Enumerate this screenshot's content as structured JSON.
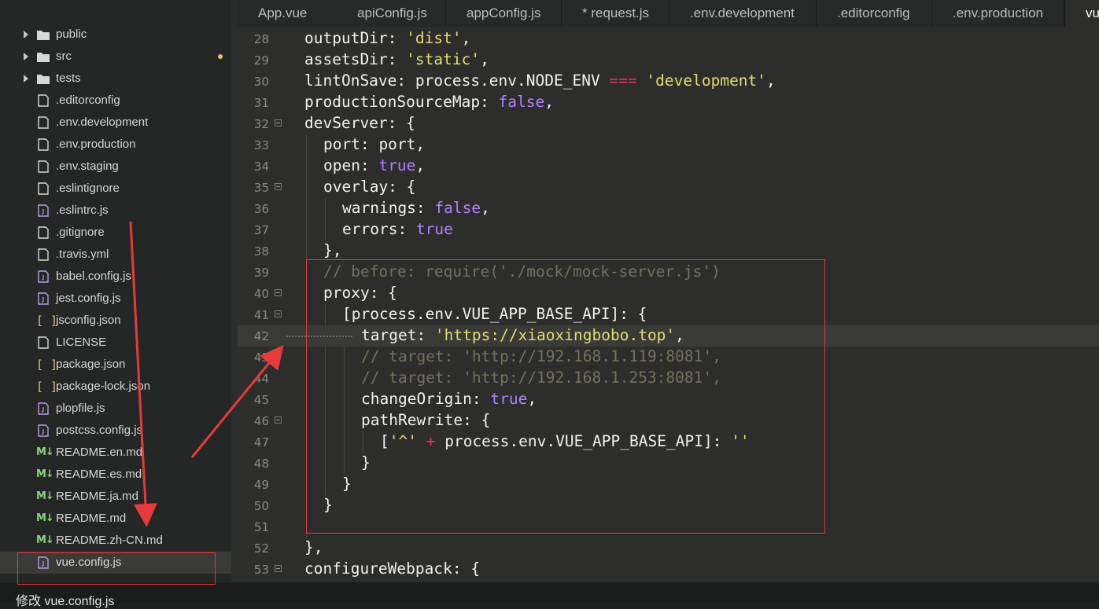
{
  "sidebar": {
    "items": [
      {
        "label": "public",
        "type": "folder"
      },
      {
        "label": "src",
        "type": "folder",
        "modified": true
      },
      {
        "label": "tests",
        "type": "folder"
      },
      {
        "label": ".editorconfig",
        "type": "file"
      },
      {
        "label": ".env.development",
        "type": "file"
      },
      {
        "label": ".env.production",
        "type": "file"
      },
      {
        "label": ".env.staging",
        "type": "file"
      },
      {
        "label": ".eslintignore",
        "type": "file"
      },
      {
        "label": ".eslintrc.js",
        "type": "js"
      },
      {
        "label": ".gitignore",
        "type": "file"
      },
      {
        "label": ".travis.yml",
        "type": "file"
      },
      {
        "label": "babel.config.js",
        "type": "js"
      },
      {
        "label": "jest.config.js",
        "type": "js"
      },
      {
        "label": "jsconfig.json",
        "type": "json"
      },
      {
        "label": "LICENSE",
        "type": "file"
      },
      {
        "label": "package.json",
        "type": "json"
      },
      {
        "label": "package-lock.json",
        "type": "json"
      },
      {
        "label": "plopfile.js",
        "type": "js"
      },
      {
        "label": "postcss.config.js",
        "type": "js"
      },
      {
        "label": "README.en.md",
        "type": "md"
      },
      {
        "label": "README.es.md",
        "type": "md"
      },
      {
        "label": "README.ja.md",
        "type": "md"
      },
      {
        "label": "README.md",
        "type": "md"
      },
      {
        "label": "README.zh-CN.md",
        "type": "md"
      },
      {
        "label": "vue.config.js",
        "type": "js",
        "selected": true
      }
    ]
  },
  "tabs": [
    {
      "label": "App.vue"
    },
    {
      "label": "apiConfig.js"
    },
    {
      "label": "appConfig.js"
    },
    {
      "label": "* request.js"
    },
    {
      "label": ".env.development"
    },
    {
      "label": ".editorconfig"
    },
    {
      "label": ".env.production"
    },
    {
      "label": "vue",
      "active": true
    }
  ],
  "editor": {
    "line_numbers": [
      "28",
      "29",
      "30",
      "31",
      "32",
      "33",
      "34",
      "35",
      "36",
      "37",
      "38",
      "39",
      "40",
      "41",
      "42",
      "43",
      "44",
      "45",
      "46",
      "47",
      "48",
      "49",
      "50",
      "51",
      "52",
      "53"
    ],
    "active_line": "42",
    "code": {
      "l28": {
        "key": "outputDir: ",
        "str": "'dist'",
        "end": ","
      },
      "l29": {
        "key": "assetsDir: ",
        "str": "'static'",
        "end": ","
      },
      "l30": {
        "key": "lintOnSave: process.env.NODE_ENV ",
        "op": "===",
        "str": "'development'",
        "end": ","
      },
      "l31": {
        "key": "productionSourceMap: ",
        "val": "false",
        "end": ","
      },
      "l32": {
        "text": "devServer: {"
      },
      "l33": {
        "text": "port: port,"
      },
      "l34": {
        "key": "open: ",
        "val": "true",
        "end": ","
      },
      "l35": {
        "text": "overlay: {"
      },
      "l36": {
        "key": "warnings: ",
        "val": "false",
        "end": ","
      },
      "l37": {
        "key": "errors: ",
        "val": "true"
      },
      "l38": {
        "text": "},"
      },
      "l39": {
        "comment": "// before: require('./mock/mock-server.js')"
      },
      "l40": {
        "text": "proxy: {"
      },
      "l41": {
        "text": "[process.env.VUE_APP_BASE_API]: {"
      },
      "l42": {
        "key": "target: ",
        "str": "'https://xiaoxingbobo.top'",
        "end": ","
      },
      "l43": {
        "comment": "// target: 'http://192.168.1.119:8081',"
      },
      "l44": {
        "comment": "// target: 'http://192.168.1.253:8081',"
      },
      "l45": {
        "key": "changeOrigin: ",
        "val": "true",
        "end": ","
      },
      "l46": {
        "text": "pathRewrite: {"
      },
      "l47": {
        "open": "[",
        "str1": "'^'",
        "op": " + ",
        "mid": "process.env.VUE_APP_BASE_API]: ",
        "str2": "''"
      },
      "l48": {
        "text": "}"
      },
      "l49": {
        "text": "}"
      },
      "l50": {
        "text": "}"
      },
      "l51": {
        "text": ""
      },
      "l52": {
        "text": "},"
      },
      "l53": {
        "text": "configureWebpack: {"
      }
    }
  },
  "status": {
    "text": "修改 vue.config.js"
  },
  "colors": {
    "annotation": "#e53b3b",
    "string": "#e6db74",
    "boolean": "#ae81ff",
    "comment": "#75715e",
    "operator": "#f92672"
  }
}
